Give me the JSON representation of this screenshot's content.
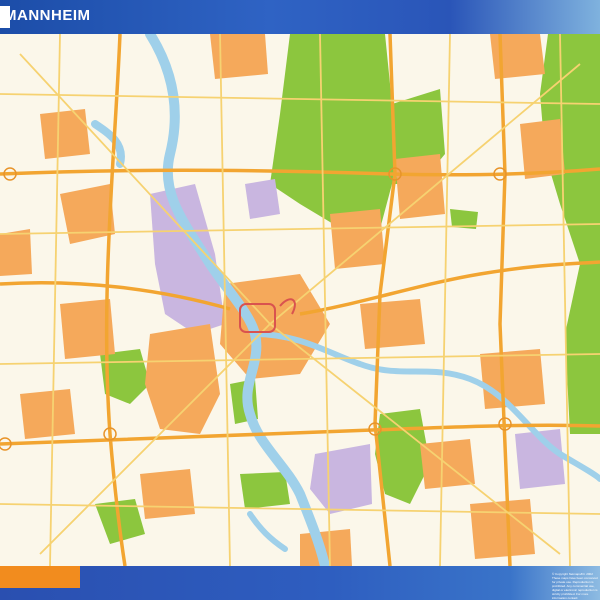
{
  "header": {
    "title": "MANNHEIM"
  },
  "footer": {
    "copyright": "© Copyright Netmaps/Dr. 2002\nThese maps have been conceived for private use. Reproduction is prohibited. Any commercial use, digital or electronic reproduction is strictly prohibited.\nFor more information contact: www.netmaps.es"
  },
  "colors": {
    "header_blue": "#2f63c4",
    "footer_blue": "#2a4fb0",
    "accent_orange": "#f28c1e",
    "river": "#9fd0ea",
    "forest": "#8cc63e",
    "urban": "#f5a95b",
    "industrial": "#c9b6e0",
    "map_background": "#fbf7ea"
  }
}
